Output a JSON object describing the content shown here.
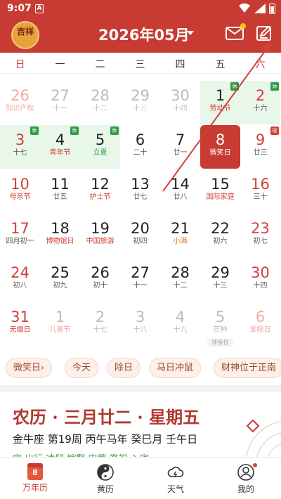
{
  "status": {
    "time": "9:07",
    "a_label": "A"
  },
  "header": {
    "logo_text": "吉祥",
    "month_title": "2026年05月",
    "icons": {
      "mail": "mail-icon",
      "edit": "edit-icon",
      "dropdown": "caret-down-icon"
    },
    "accent": "#c83b32"
  },
  "weekdays": [
    "日",
    "一",
    "二",
    "三",
    "四",
    "五",
    "六"
  ],
  "calendar": {
    "rows": [
      [
        {
          "n": "26",
          "s": "知识产权",
          "dim": true,
          "we": true,
          "sc": "red"
        },
        {
          "n": "27",
          "s": "十一",
          "dim": true
        },
        {
          "n": "28",
          "s": "十二",
          "dim": true
        },
        {
          "n": "29",
          "s": "十三",
          "dim": true
        },
        {
          "n": "30",
          "s": "十四",
          "dim": true
        },
        {
          "n": "1",
          "s": "劳动节",
          "sc": "red",
          "green": true,
          "badge": "休"
        },
        {
          "n": "2",
          "s": "十六",
          "we": true,
          "green": true,
          "badge": "休"
        }
      ],
      [
        {
          "n": "3",
          "s": "十七",
          "we": true,
          "green": true,
          "badge": "休"
        },
        {
          "n": "4",
          "s": "青年节",
          "sc": "red",
          "green": true,
          "badge": "休"
        },
        {
          "n": "5",
          "s": "立夏",
          "sc": "green",
          "green": true,
          "badge": "休"
        },
        {
          "n": "6",
          "s": "二十"
        },
        {
          "n": "7",
          "s": "廿一"
        },
        {
          "n": "8",
          "s": "微笑日",
          "today": true
        },
        {
          "n": "9",
          "s": "廿三",
          "we": true,
          "badge": "班"
        }
      ],
      [
        {
          "n": "10",
          "s": "母亲节",
          "we": true,
          "sc": "red"
        },
        {
          "n": "11",
          "s": "廿五"
        },
        {
          "n": "12",
          "s": "护士节",
          "sc": "red"
        },
        {
          "n": "13",
          "s": "廿七"
        },
        {
          "n": "14",
          "s": "廿八"
        },
        {
          "n": "15",
          "s": "国际家庭",
          "sc": "red"
        },
        {
          "n": "16",
          "s": "三十",
          "we": true
        }
      ],
      [
        {
          "n": "17",
          "s": "四月初一",
          "we": true
        },
        {
          "n": "18",
          "s": "博物馆日",
          "sc": "red"
        },
        {
          "n": "19",
          "s": "中国旅游",
          "sc": "red"
        },
        {
          "n": "20",
          "s": "初四"
        },
        {
          "n": "21",
          "s": "小满",
          "sc": "orange"
        },
        {
          "n": "22",
          "s": "初六"
        },
        {
          "n": "23",
          "s": "初七",
          "we": true
        }
      ],
      [
        {
          "n": "24",
          "s": "初八",
          "we": true
        },
        {
          "n": "25",
          "s": "初九"
        },
        {
          "n": "26",
          "s": "初十"
        },
        {
          "n": "27",
          "s": "十一"
        },
        {
          "n": "28",
          "s": "十二"
        },
        {
          "n": "29",
          "s": "十三"
        },
        {
          "n": "30",
          "s": "十四",
          "we": true
        }
      ],
      [
        {
          "n": "31",
          "s": "无烟日",
          "we": true,
          "sc": "red"
        },
        {
          "n": "1",
          "s": "儿童节",
          "dim": true,
          "sc": "red"
        },
        {
          "n": "2",
          "s": "十七",
          "dim": true
        },
        {
          "n": "3",
          "s": "十八",
          "dim": true
        },
        {
          "n": "4",
          "s": "十九",
          "dim": true
        },
        {
          "n": "5",
          "s": "芒种",
          "dim": true,
          "tag": "环保日"
        },
        {
          "n": "6",
          "s": "爱眼日",
          "dim": true,
          "we": true,
          "sc": "red"
        }
      ]
    ],
    "colors": {
      "weekend": "#d0413a",
      "holiday_bg": "#e9f6ea",
      "rest_badge": "#2f9a45"
    }
  },
  "chips": [
    "微笑日",
    "今天",
    "除日",
    "马日冲鼠",
    "财神位于正南"
  ],
  "chip_caret": "›",
  "info": {
    "lunar_line": "农历 · 三月廿二 · 星期五",
    "zodiac_line": "金牛座 第19周 丙午马年 癸巳月 壬午日",
    "cut_line": "宜 出行 冲鼠 嫁娶 安葬 祭祀 入宅"
  },
  "nav": [
    {
      "label": "万年历",
      "icon": "calendar-icon",
      "cal_num": "8",
      "active": true
    },
    {
      "label": "黄历",
      "icon": "yin-yang-icon"
    },
    {
      "label": "天气",
      "icon": "weather-icon"
    },
    {
      "label": "我的",
      "icon": "user-icon"
    }
  ]
}
